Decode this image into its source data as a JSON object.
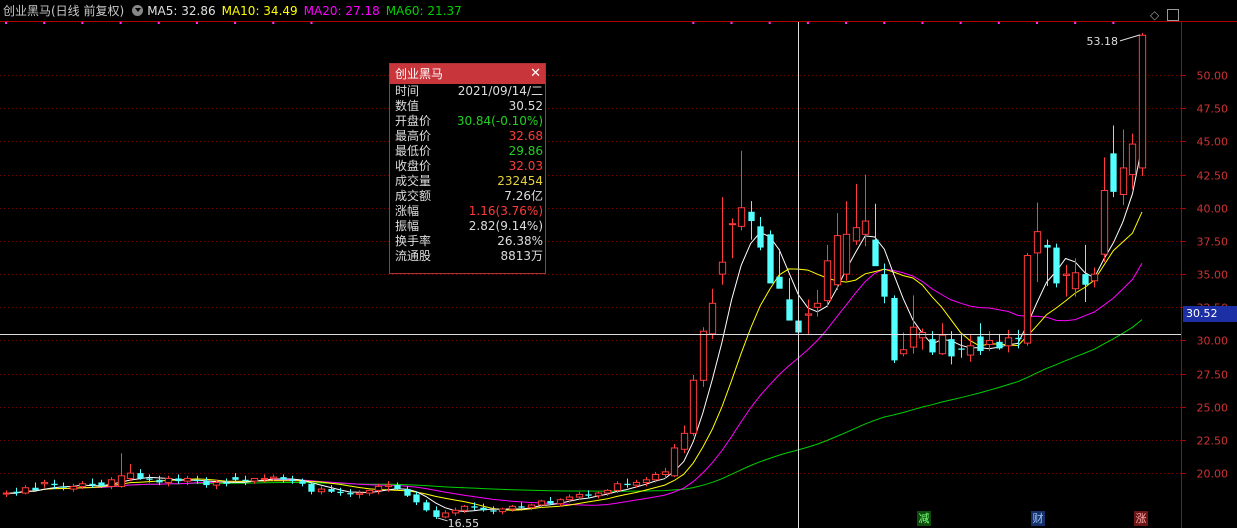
{
  "header": {
    "title": "创业黑马(日线 前复权)",
    "ma5": "MA5: 32.86",
    "ma10": "MA10: 34.49",
    "ma20": "MA20: 27.18",
    "ma60": "MA60: 21.37"
  },
  "colors": {
    "up": "#ff3b3b",
    "down": "#54ffff",
    "ma5": "#ffffff",
    "ma10": "#ffff00",
    "ma20": "#ff00ff",
    "ma60": "#00d000",
    "grid": "#7a0000",
    "axis": "#b40000"
  },
  "tooltip": {
    "title": "创业黑马",
    "rows": [
      {
        "k": "时间",
        "v": "2021/09/14/二",
        "c": "#dddddd"
      },
      {
        "k": "数值",
        "v": "30.52",
        "c": "#dddddd"
      },
      {
        "k": "开盘价",
        "v": "30.84(-0.10%)",
        "c": "#22d022"
      },
      {
        "k": "最高价",
        "v": "32.68",
        "c": "#ff3b3b"
      },
      {
        "k": "最低价",
        "v": "29.86",
        "c": "#22d022"
      },
      {
        "k": "收盘价",
        "v": "32.03",
        "c": "#ff3b3b"
      },
      {
        "k": "成交量",
        "v": "232454",
        "c": "#e6d23a"
      },
      {
        "k": "成交额",
        "v": "7.26亿",
        "c": "#dddddd"
      },
      {
        "k": "涨幅",
        "v": "1.16(3.76%)",
        "c": "#ff3b3b"
      },
      {
        "k": "振幅",
        "v": "2.82(9.14%)",
        "c": "#dddddd"
      },
      {
        "k": "换手率",
        "v": "26.38%",
        "c": "#dddddd"
      },
      {
        "k": "流通股",
        "v": "8813万",
        "c": "#dddddd"
      }
    ]
  },
  "price_label": "30.52",
  "markers": [
    "减",
    "财",
    "涨"
  ],
  "chart_data": {
    "type": "candlestick",
    "ylim": [
      17.6,
      54.0
    ],
    "yticks": [
      20.0,
      22.5,
      25.0,
      27.5,
      30.0,
      32.5,
      35.0,
      37.5,
      40.0,
      42.5,
      45.0,
      47.5,
      50.0
    ],
    "ytick_labels": [
      "20.00",
      "22.50",
      "25.00",
      "27.50",
      "30.00",
      "32.50",
      "35.00",
      "37.50",
      "40.00",
      "42.50",
      "45.00",
      "47.50",
      "50.00"
    ],
    "crosshair_value": 30.52,
    "annotations": [
      {
        "text": "53.18",
        "value": 53.18,
        "kind": "high"
      },
      {
        "text": "16.55",
        "value": 16.55,
        "kind": "low"
      }
    ],
    "candles": [
      [
        18.5,
        18.7,
        18.2,
        18.5
      ],
      [
        18.6,
        18.9,
        18.3,
        18.5
      ],
      [
        18.5,
        19.1,
        18.4,
        18.9
      ],
      [
        18.9,
        19.3,
        18.6,
        18.7
      ],
      [
        19.2,
        19.5,
        18.9,
        19.3
      ],
      [
        19.2,
        19.5,
        18.8,
        19.1
      ],
      [
        19.0,
        19.3,
        18.7,
        18.9
      ],
      [
        18.8,
        19.2,
        18.6,
        19.0
      ],
      [
        19.0,
        19.4,
        18.8,
        19.2
      ],
      [
        19.2,
        19.6,
        18.9,
        19.1
      ],
      [
        19.3,
        19.5,
        18.9,
        19.0
      ],
      [
        19.0,
        19.7,
        18.8,
        19.5
      ],
      [
        19.0,
        21.5,
        18.9,
        19.8
      ],
      [
        19.6,
        20.7,
        19.4,
        20.0
      ],
      [
        20.0,
        20.3,
        19.5,
        19.6
      ],
      [
        19.6,
        19.9,
        19.3,
        19.5
      ],
      [
        19.5,
        19.8,
        19.1,
        19.3
      ],
      [
        19.3,
        19.8,
        19.0,
        19.6
      ],
      [
        19.6,
        19.9,
        19.2,
        19.4
      ],
      [
        19.4,
        19.8,
        19.1,
        19.6
      ],
      [
        19.5,
        19.8,
        19.2,
        19.4
      ],
      [
        19.4,
        19.7,
        18.9,
        19.1
      ],
      [
        19.1,
        19.5,
        18.8,
        19.3
      ],
      [
        19.3,
        19.6,
        19.0,
        19.2
      ],
      [
        19.7,
        20.0,
        19.4,
        19.5
      ],
      [
        19.5,
        19.8,
        19.1,
        19.4
      ],
      [
        19.4,
        19.6,
        19.2,
        19.6
      ],
      [
        19.6,
        19.9,
        19.3,
        19.6
      ],
      [
        19.6,
        19.9,
        19.4,
        19.7
      ],
      [
        19.7,
        19.9,
        19.3,
        19.5
      ],
      [
        19.5,
        19.8,
        19.2,
        19.4
      ],
      [
        19.4,
        19.6,
        19.0,
        19.2
      ],
      [
        19.2,
        19.4,
        18.4,
        18.6
      ],
      [
        18.6,
        19.0,
        18.4,
        18.8
      ],
      [
        18.8,
        19.1,
        18.5,
        18.6
      ],
      [
        18.6,
        18.9,
        18.3,
        18.5
      ],
      [
        18.5,
        18.8,
        18.2,
        18.4
      ],
      [
        18.4,
        18.7,
        18.1,
        18.5
      ],
      [
        18.5,
        18.8,
        18.3,
        18.7
      ],
      [
        18.7,
        19.2,
        18.4,
        19.0
      ],
      [
        19.0,
        19.4,
        18.6,
        19.1
      ],
      [
        19.1,
        19.3,
        18.7,
        18.8
      ],
      [
        18.8,
        19.0,
        18.2,
        18.3
      ],
      [
        18.4,
        18.6,
        17.6,
        17.8
      ],
      [
        17.8,
        18.0,
        17.1,
        17.2
      ],
      [
        17.2,
        17.5,
        16.55,
        16.7
      ],
      [
        16.7,
        17.2,
        16.6,
        17.0
      ],
      [
        17.0,
        17.4,
        16.8,
        17.2
      ],
      [
        17.2,
        17.6,
        17.0,
        17.5
      ],
      [
        17.5,
        17.8,
        17.2,
        17.4
      ],
      [
        17.4,
        17.7,
        17.1,
        17.2
      ],
      [
        17.2,
        17.5,
        16.9,
        17.1
      ],
      [
        17.1,
        17.4,
        16.9,
        17.3
      ],
      [
        17.3,
        17.6,
        17.1,
        17.5
      ],
      [
        17.5,
        17.8,
        17.2,
        17.4
      ],
      [
        17.4,
        17.7,
        17.2,
        17.6
      ],
      [
        17.6,
        18.0,
        17.4,
        17.9
      ],
      [
        17.9,
        18.2,
        17.6,
        17.7
      ],
      [
        17.7,
        18.1,
        17.5,
        18.0
      ],
      [
        18.0,
        18.4,
        17.8,
        18.2
      ],
      [
        18.2,
        18.6,
        18.0,
        18.4
      ],
      [
        18.4,
        18.7,
        18.1,
        18.3
      ],
      [
        18.3,
        18.6,
        18.1,
        18.5
      ],
      [
        18.5,
        18.8,
        18.3,
        18.7
      ],
      [
        18.7,
        19.4,
        18.5,
        19.2
      ],
      [
        19.2,
        19.6,
        18.9,
        19.1
      ],
      [
        19.1,
        19.5,
        18.9,
        19.3
      ],
      [
        19.3,
        19.7,
        19.0,
        19.5
      ],
      [
        19.5,
        20.1,
        19.3,
        19.9
      ],
      [
        19.9,
        20.4,
        19.6,
        20.1
      ],
      [
        19.8,
        22.2,
        19.7,
        21.9
      ],
      [
        21.8,
        23.6,
        21.5,
        23.0
      ],
      [
        23.0,
        27.4,
        22.8,
        27.0
      ],
      [
        27.0,
        31.0,
        26.5,
        30.7
      ],
      [
        30.5,
        33.9,
        30.1,
        32.8
      ],
      [
        35.0,
        40.8,
        34.2,
        35.9
      ],
      [
        38.8,
        39.2,
        36.2,
        38.8
      ],
      [
        38.6,
        44.3,
        38.3,
        40.0
      ],
      [
        39.7,
        40.5,
        37.6,
        39.0
      ],
      [
        38.6,
        39.3,
        36.8,
        37.0
      ],
      [
        38.0,
        38.3,
        34.5,
        34.3
      ],
      [
        34.8,
        36.9,
        34.1,
        33.9
      ],
      [
        33.1,
        34.7,
        32.0,
        31.5
      ],
      [
        31.5,
        32.7,
        30.5,
        30.6
      ],
      [
        31.9,
        33.1,
        30.5,
        32.0
      ],
      [
        32.5,
        33.8,
        31.8,
        32.8
      ],
      [
        33.0,
        37.2,
        32.5,
        36.0
      ],
      [
        34.2,
        39.6,
        33.8,
        37.9
      ],
      [
        35.0,
        40.5,
        34.5,
        38.0
      ],
      [
        37.5,
        41.8,
        37.2,
        38.5
      ],
      [
        38.0,
        42.5,
        37.1,
        39.0
      ],
      [
        37.6,
        40.3,
        36.0,
        35.6
      ],
      [
        35.0,
        35.8,
        32.8,
        33.3
      ],
      [
        33.2,
        33.4,
        28.3,
        28.5
      ],
      [
        29.0,
        30.6,
        28.8,
        29.3
      ],
      [
        29.5,
        33.4,
        29.0,
        31.0
      ],
      [
        30.2,
        30.9,
        29.3,
        30.6
      ],
      [
        30.1,
        30.7,
        28.9,
        29.1
      ],
      [
        29.0,
        31.3,
        28.9,
        30.4
      ],
      [
        30.1,
        30.7,
        28.2,
        28.8
      ],
      [
        29.4,
        30.4,
        28.7,
        29.3
      ],
      [
        28.9,
        30.4,
        28.4,
        29.6
      ],
      [
        30.3,
        31.3,
        28.9,
        29.2
      ],
      [
        29.7,
        30.7,
        29.2,
        30.0
      ],
      [
        29.9,
        30.5,
        29.3,
        29.4
      ],
      [
        29.6,
        30.8,
        29.1,
        30.2
      ],
      [
        30.2,
        30.8,
        29.4,
        30.1
      ],
      [
        29.8,
        36.6,
        29.6,
        36.4
      ],
      [
        36.6,
        40.4,
        34.4,
        38.2
      ],
      [
        37.2,
        37.6,
        34.1,
        37.0
      ],
      [
        37.0,
        37.3,
        34.0,
        34.3
      ],
      [
        34.9,
        35.7,
        33.3,
        35.0
      ],
      [
        33.9,
        36.2,
        33.3,
        35.1
      ],
      [
        35.0,
        37.2,
        32.9,
        34.2
      ],
      [
        34.5,
        35.5,
        34.0,
        35.0
      ],
      [
        36.5,
        43.8,
        35.9,
        41.3
      ],
      [
        44.1,
        46.2,
        40.8,
        41.2
      ],
      [
        41.0,
        45.9,
        40.2,
        43.0
      ],
      [
        42.5,
        45.6,
        41.4,
        44.8
      ],
      [
        43.0,
        53.18,
        42.4,
        53.0
      ]
    ]
  }
}
